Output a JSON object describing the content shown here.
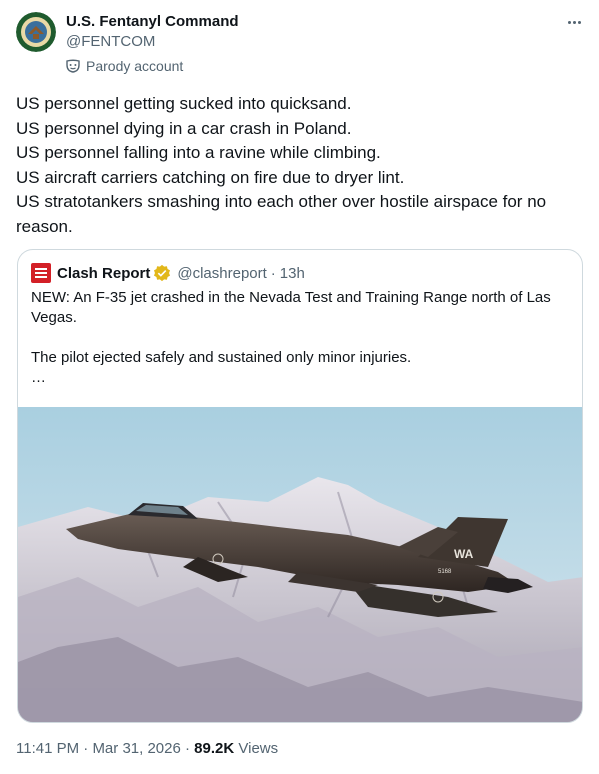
{
  "author": {
    "name": "U.S. Fentanyl Command",
    "handle": "@FENTCOM",
    "label": "Parody account"
  },
  "tweet": {
    "lines": [
      "US personnel getting sucked into quicksand.",
      "US personnel dying in a car crash in Poland.",
      "US personnel falling into a ravine while climbing.",
      "US aircraft carriers catching on fire due to dryer lint.",
      "US stratotankers smashing into each other over hostile airspace for no",
      "reason."
    ]
  },
  "quote": {
    "name": "Clash Report",
    "handle": "@clashreport",
    "separator": "·",
    "time": "13h",
    "text_line1": "NEW: An F-35 jet crashed in the Nevada Test and Training Range north of Las",
    "text_line2": "Vegas.",
    "text_line3": "The pilot ejected safely and sustained only minor injuries.",
    "ellipsis": "…",
    "image": {
      "tail_code": "WA",
      "tail_number": "5168"
    }
  },
  "footer": {
    "time": "11:41 PM",
    "date": "Mar 31, 2026",
    "views_count": "89.2K",
    "views_label": "Views",
    "sep": "·"
  },
  "colors": {
    "text": "#0f1419",
    "secondary": "#536471",
    "border": "#cfd9de",
    "verified_gold": "#e2b719",
    "brand_red": "#d32027"
  }
}
